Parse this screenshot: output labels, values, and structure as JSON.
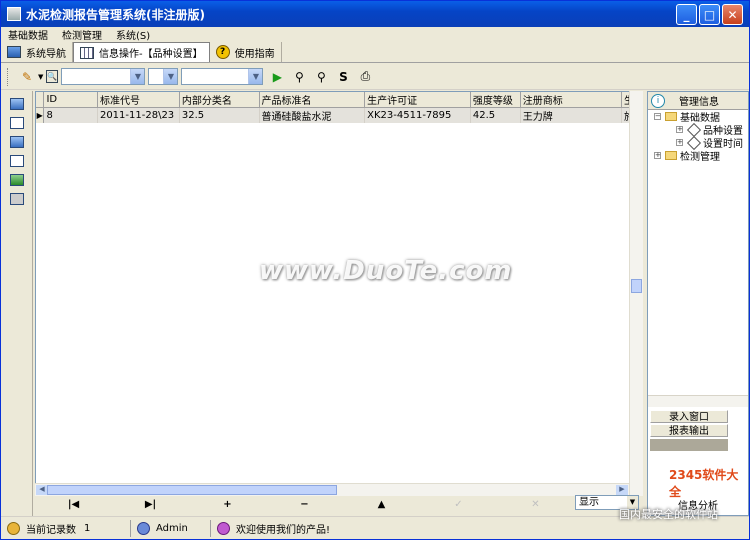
{
  "window": {
    "title": "水泥检测报告管理系统(非注册版)",
    "minimize": "_",
    "maximize": "□",
    "close": "✕"
  },
  "menubar": [
    "基础数据",
    "检测管理",
    "系统(S)"
  ],
  "tabs": [
    {
      "label": "系统导航",
      "icon": "monitor-icon"
    },
    {
      "label": "信息操作-【品种设置】",
      "icon": "grid-icon"
    },
    {
      "label": "使用指南",
      "icon": "help-icon"
    }
  ],
  "toolbar": {
    "icons": [
      "pencil-icon",
      "search-icon",
      "play-icon",
      "find-icon",
      "find-next-icon",
      "refresh-icon",
      "print-icon"
    ]
  },
  "table": {
    "columns": [
      "ID",
      "标准代号",
      "内部分类名",
      "产品标准名",
      "生产许可证",
      "强度等级",
      "注册商标",
      "生"
    ],
    "rows": [
      [
        "8",
        "2011-11-28\\23",
        "32.5",
        "普通硅酸盐水泥",
        "XK23-4511-7895",
        "42.5",
        "王力牌",
        "施"
      ]
    ]
  },
  "navigator": {
    "first": "|◀",
    "prev": "▶|",
    "add": "+",
    "remove": "−",
    "up": "▲",
    "post": "✓",
    "cancel": "✕",
    "show_label": "显示"
  },
  "right_panel": {
    "title": "管理信息",
    "tree": [
      {
        "label": "基础数据",
        "expanded": true,
        "children": [
          "品种设置",
          "设置时间"
        ]
      },
      {
        "label": "检测管理",
        "expanded": false
      }
    ],
    "buttons": [
      "录入窗口",
      "报表输出"
    ],
    "bottom": "信息分析"
  },
  "status": {
    "records_label": "当前记录数",
    "records_value": "1",
    "user": "Admin",
    "message": "欢迎使用我们的产品!"
  },
  "watermark": {
    "main": "www.DuoTe.com",
    "logo": "2345软件大全",
    "sub": "国内最安全的软件站"
  }
}
